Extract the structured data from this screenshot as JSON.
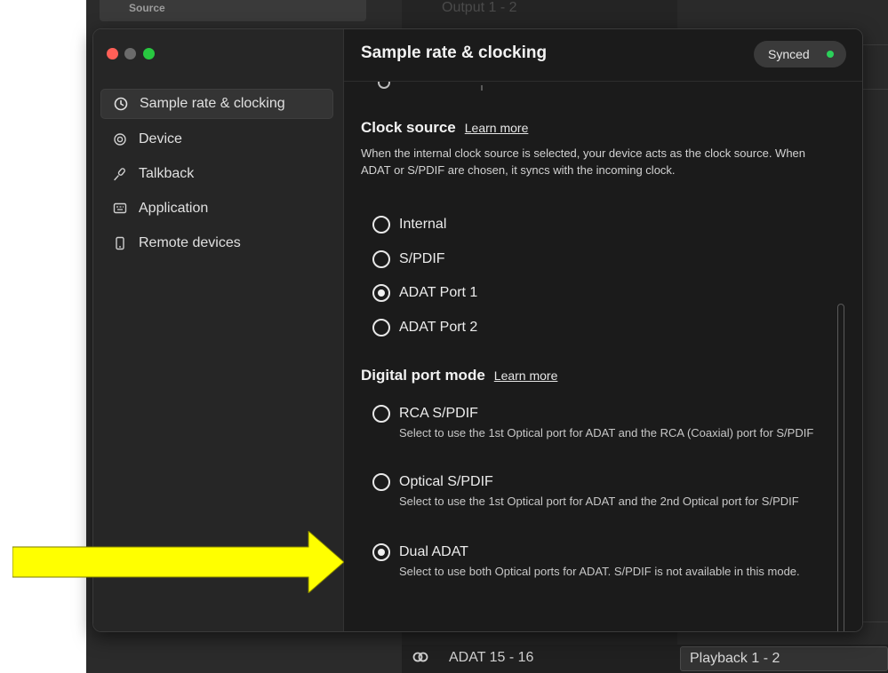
{
  "background": {
    "source_label": "Source",
    "output_label": "Output 1 - 2",
    "bottom_row": {
      "label": "ADAT 15 - 16",
      "playback_select": "Playback 1 - 2",
      "icon": "link-rings-icon"
    }
  },
  "window": {
    "title": "Sample rate & clocking",
    "sync_status": "Synced",
    "sync_color": "#2bd05a"
  },
  "sidebar": {
    "items": [
      {
        "label": "Sample rate & clocking",
        "icon": "clock-icon",
        "active": true
      },
      {
        "label": "Device",
        "icon": "device-icon",
        "active": false
      },
      {
        "label": "Talkback",
        "icon": "microphone-icon",
        "active": false
      },
      {
        "label": "Application",
        "icon": "application-icon",
        "active": false
      },
      {
        "label": "Remote devices",
        "icon": "phone-icon",
        "active": false
      }
    ]
  },
  "clock_source": {
    "title": "Clock source",
    "learn_more": "Learn more",
    "description": "When the internal clock source is selected, your device acts as the clock source. When ADAT or S/PDIF are chosen, it syncs with the incoming clock.",
    "options": [
      {
        "label": "Internal",
        "selected": false
      },
      {
        "label": "S/PDIF",
        "selected": false
      },
      {
        "label": "ADAT Port 1",
        "selected": true
      },
      {
        "label": "ADAT Port 2",
        "selected": false
      }
    ]
  },
  "digital_port_mode": {
    "title": "Digital port mode",
    "learn_more": "Learn more",
    "options": [
      {
        "label": "RCA S/PDIF",
        "description": "Select to use the 1st Optical port for ADAT and the RCA (Coaxial) port for S/PDIF",
        "selected": false
      },
      {
        "label": "Optical S/PDIF",
        "description": "Select to use the 1st Optical port for ADAT and the 2nd Optical port for S/PDIF",
        "selected": false
      },
      {
        "label": "Dual ADAT",
        "description": "Select to use both Optical ports for ADAT. S/PDIF is not available in this mode.",
        "selected": true
      }
    ]
  },
  "annotation": {
    "arrow_color": "#ffff00"
  }
}
